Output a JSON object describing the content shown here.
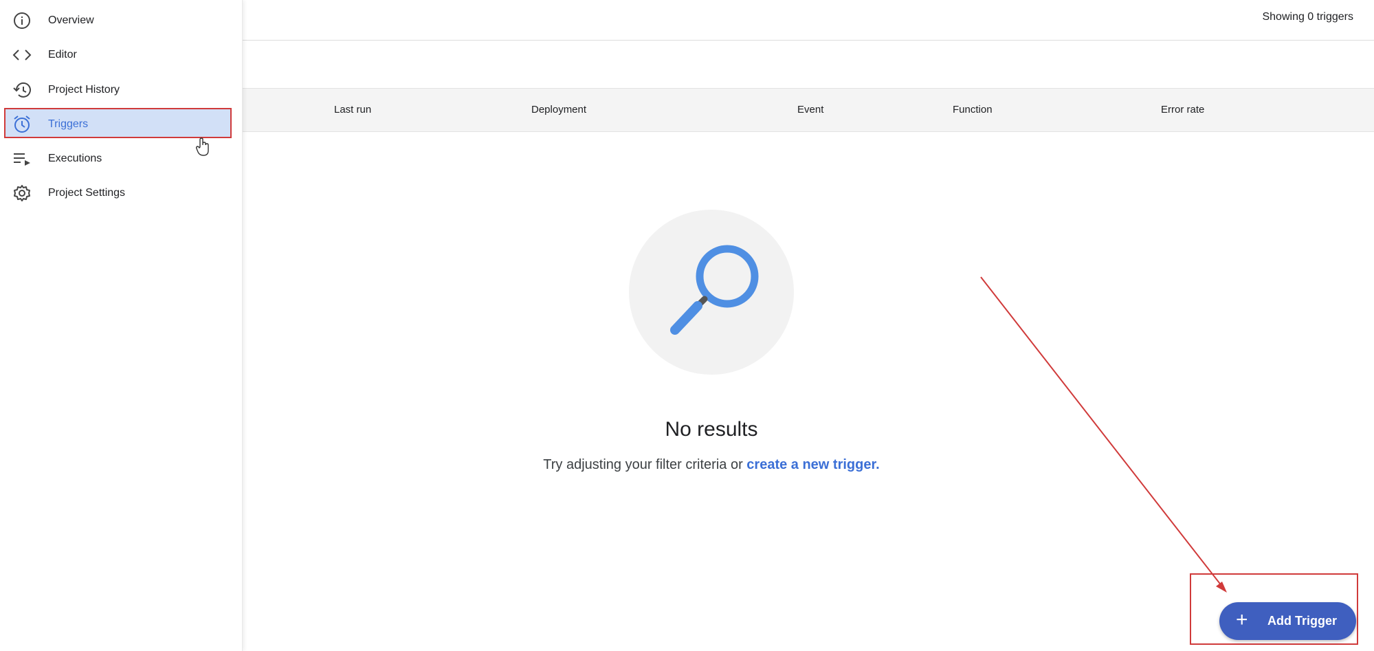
{
  "sidebar": {
    "items": [
      {
        "label": "Overview",
        "icon": "info-icon"
      },
      {
        "label": "Editor",
        "icon": "code-icon"
      },
      {
        "label": "Project History",
        "icon": "history-icon"
      },
      {
        "label": "Triggers",
        "icon": "alarm-clock-icon"
      },
      {
        "label": "Executions",
        "icon": "executions-list-icon"
      },
      {
        "label": "Project Settings",
        "icon": "gear-icon"
      }
    ],
    "active_index": 3
  },
  "header": {
    "showing": "Showing 0 triggers"
  },
  "table": {
    "columns": [
      "Last run",
      "Deployment",
      "Event",
      "Function",
      "Error rate"
    ]
  },
  "empty_state": {
    "title": "No results",
    "hint": "Try adjusting your filter criteria or",
    "link": "create a new trigger."
  },
  "fab": {
    "label": "Add Trigger",
    "icon": "plus-icon"
  },
  "colors": {
    "accent": "#3b6fd6",
    "fab": "#3f5fbf",
    "annotation": "#d03a3a",
    "active_bg": "#d2e0f7"
  }
}
